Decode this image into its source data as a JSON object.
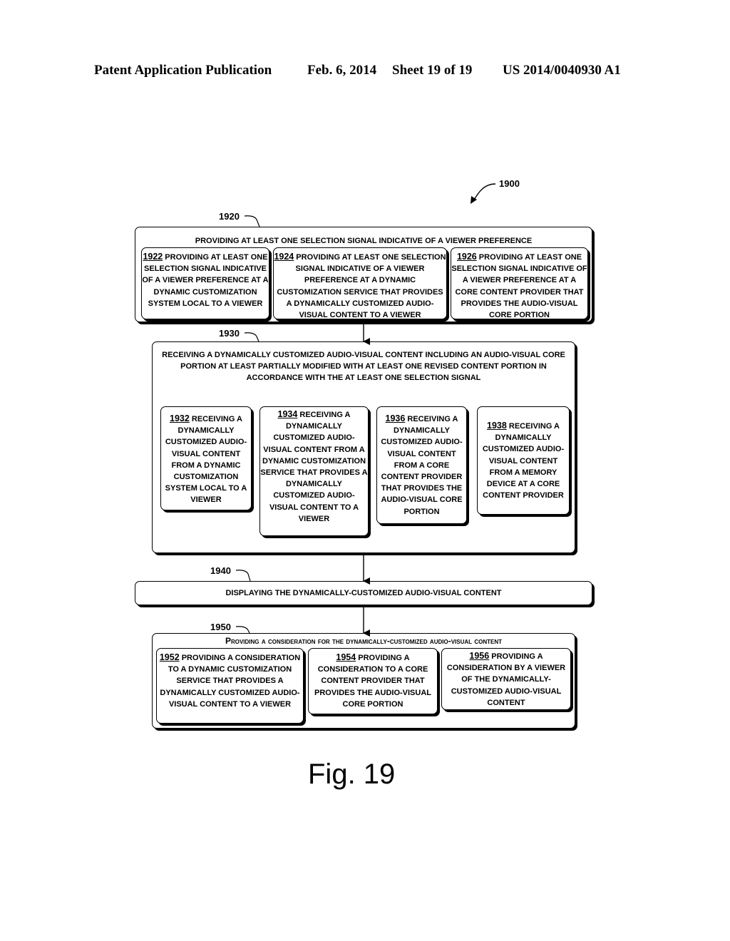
{
  "header": {
    "publication": "Patent Application Publication",
    "date": "Feb. 6, 2014",
    "sheet": "Sheet 19 of 19",
    "patent_number": "US 2014/0040930 A1"
  },
  "diagram_ref": "1900",
  "steps": {
    "s1920": {
      "ref": "1920",
      "title": "PROVIDING AT LEAST ONE SELECTION SIGNAL INDICATIVE OF A VIEWER PREFERENCE",
      "options": [
        {
          "num": "1922",
          "text": " PROVIDING AT LEAST ONE SELECTION SIGNAL INDICATIVE OF A VIEWER PREFERENCE AT A DYNAMIC CUSTOMIZATION SYSTEM LOCAL TO A VIEWER"
        },
        {
          "num": "1924",
          "text": " PROVIDING AT LEAST ONE SELECTION SIGNAL INDICATIVE OF A VIEWER PREFERENCE AT A DYNAMIC CUSTOMIZATION SERVICE THAT PROVIDES A DYNAMICALLY CUSTOMIZED AUDIO-VISUAL CONTENT TO A VIEWER"
        },
        {
          "num": "1926",
          "text": " PROVIDING AT LEAST ONE SELECTION SIGNAL INDICATIVE OF A VIEWER PREFERENCE AT A CORE CONTENT PROVIDER THAT PROVIDES THE AUDIO-VISUAL CORE PORTION"
        }
      ]
    },
    "s1930": {
      "ref": "1930",
      "title": "RECEIVING A DYNAMICALLY CUSTOMIZED AUDIO-VISUAL CONTENT INCLUDING AN AUDIO-VISUAL CORE PORTION AT LEAST PARTIALLY MODIFIED WITH AT LEAST ONE REVISED CONTENT PORTION IN ACCORDANCE WITH THE AT LEAST ONE SELECTION SIGNAL",
      "options": [
        {
          "num": "1932",
          "text": " RECEIVING A DYNAMICALLY CUSTOMIZED AUDIO-VISUAL CONTENT FROM A DYNAMIC CUSTOMIZATION SYSTEM LOCAL TO A VIEWER"
        },
        {
          "num": "1934",
          "text": " RECEIVING A DYNAMICALLY CUSTOMIZED AUDIO-VISUAL CONTENT FROM A DYNAMIC CUSTOMIZATION SERVICE THAT PROVIDES A DYNAMICALLY CUSTOMIZED AUDIO-VISUAL CONTENT TO A VIEWER"
        },
        {
          "num": "1936",
          "text": " RECEIVING A DYNAMICALLY CUSTOMIZED AUDIO-VISUAL CONTENT FROM A CORE CONTENT PROVIDER THAT PROVIDES THE AUDIO-VISUAL CORE PORTION"
        },
        {
          "num": "1938",
          "text": " RECEIVING A DYNAMICALLY CUSTOMIZED AUDIO-VISUAL CONTENT FROM A MEMORY DEVICE AT A CORE CONTENT PROVIDER"
        }
      ]
    },
    "s1940": {
      "ref": "1940",
      "title": "DISPLAYING THE DYNAMICALLY-CUSTOMIZED AUDIO-VISUAL CONTENT"
    },
    "s1950": {
      "ref": "1950",
      "title": "Providing a consideration for the dynamically-customized audio-visual content",
      "options": [
        {
          "num": "1952",
          "text": " PROVIDING A CONSIDERATION TO A DYNAMIC CUSTOMIZATION SERVICE THAT PROVIDES A DYNAMICALLY CUSTOMIZED AUDIO-VISUAL CONTENT TO A VIEWER"
        },
        {
          "num": "1954",
          "text": " PROVIDING A CONSIDERATION TO A CORE CONTENT PROVIDER THAT PROVIDES THE AUDIO-VISUAL CORE PORTION"
        },
        {
          "num": "1956",
          "text": " PROVIDING A CONSIDERATION BY A VIEWER OF THE DYNAMICALLY-CUSTOMIZED AUDIO-VISUAL CONTENT"
        }
      ]
    }
  },
  "figure_label": "Fig. 19"
}
